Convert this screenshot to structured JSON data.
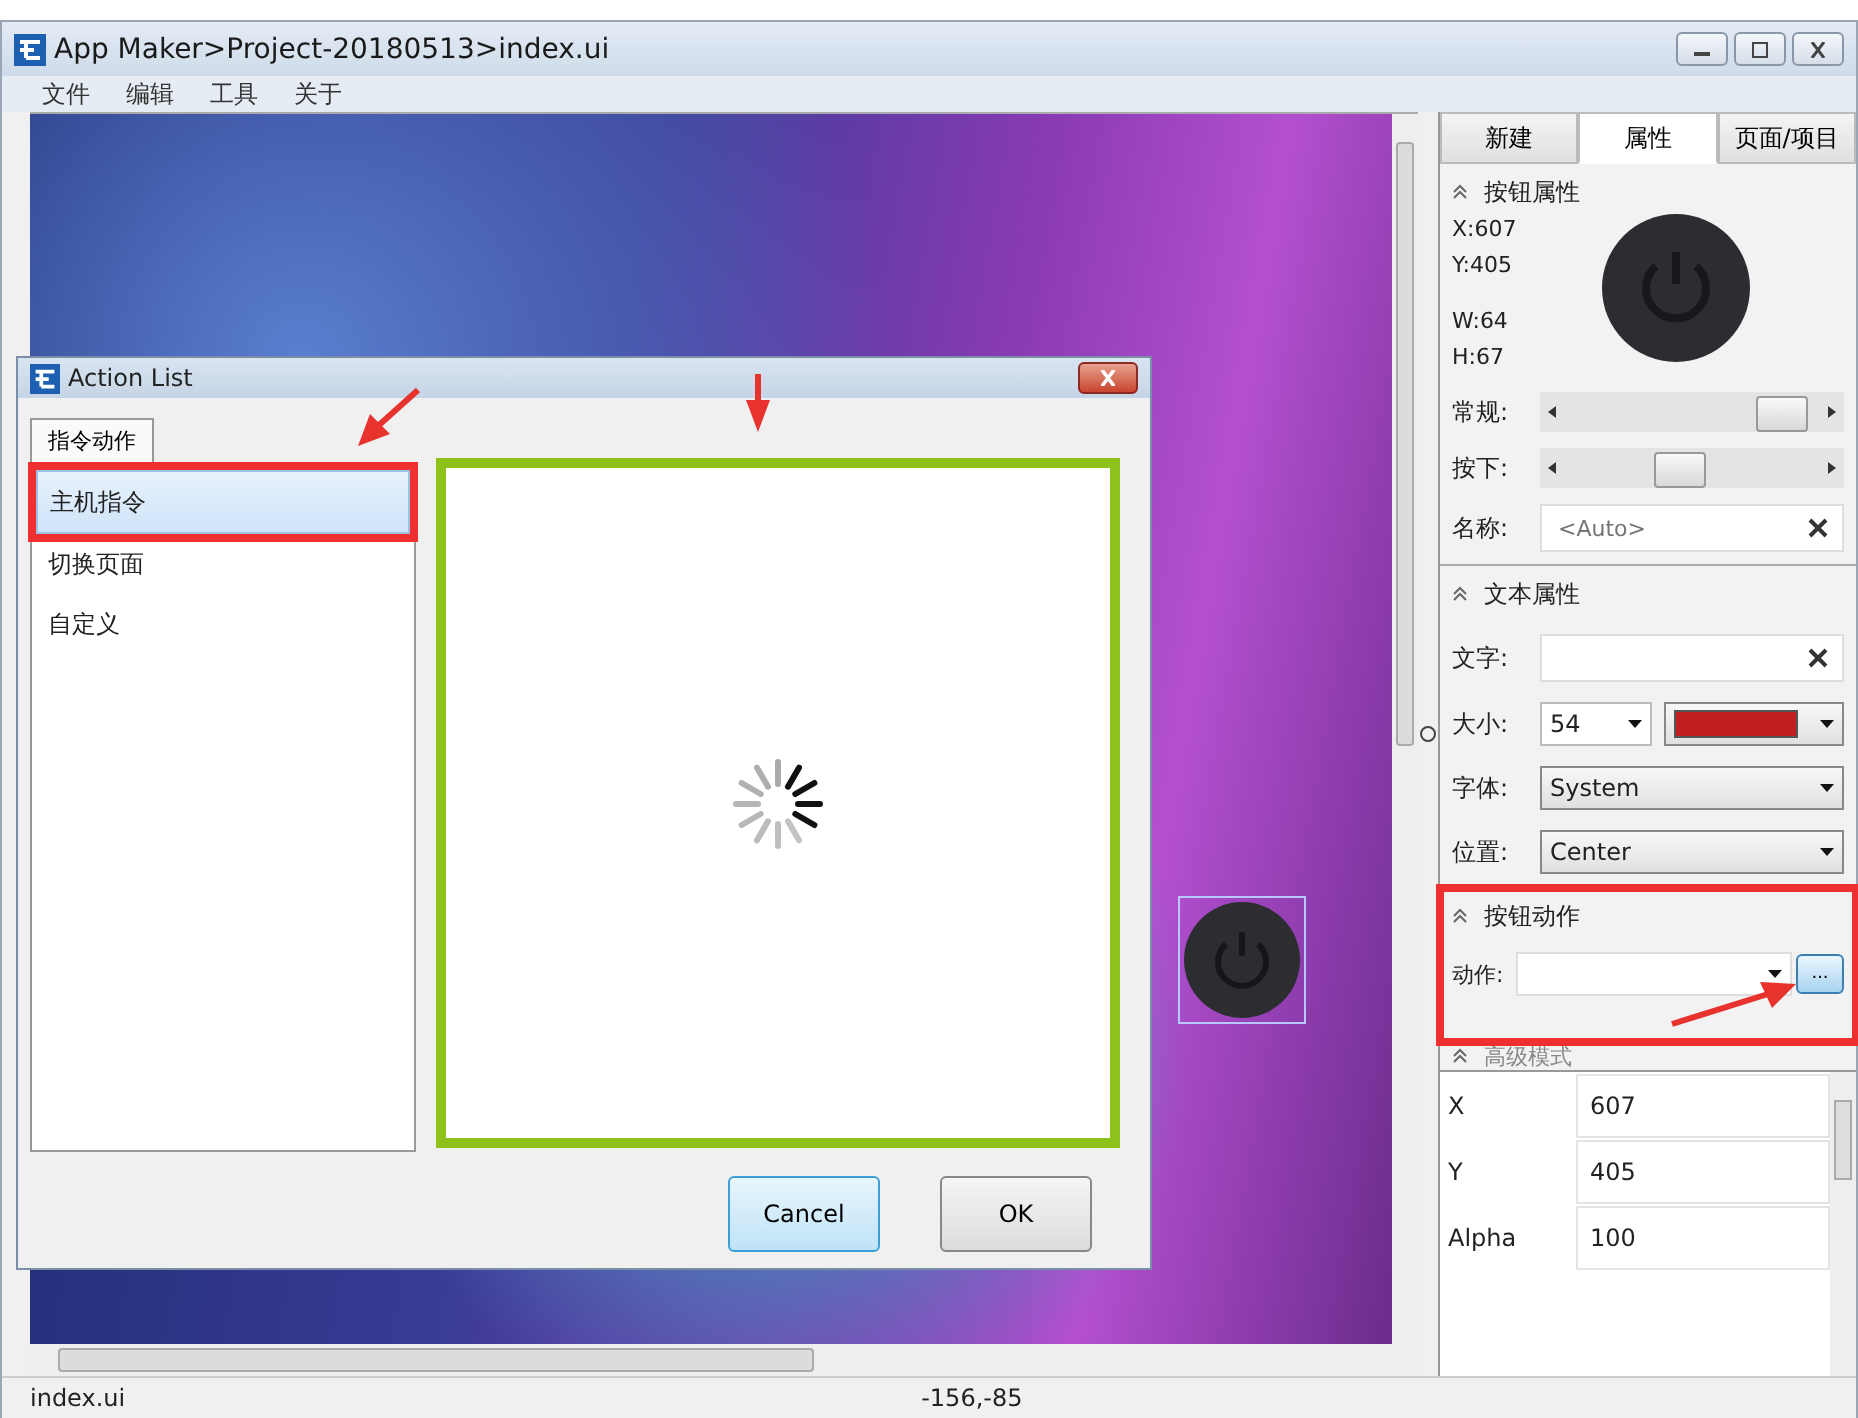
{
  "window": {
    "title": "App Maker>Project-20180513>index.ui"
  },
  "menu": [
    "文件",
    "编辑",
    "工具",
    "关于"
  ],
  "canvas": {
    "widget_selected": true
  },
  "right_panel": {
    "tabs": [
      {
        "label": "新建",
        "selected": false
      },
      {
        "label": "属性",
        "selected": true
      },
      {
        "label": "页面/项目",
        "selected": false
      }
    ],
    "button_props": {
      "title": "按钮属性",
      "x": "X:607",
      "y": "Y:405",
      "w": "W:64",
      "h": "H:67",
      "sliders": [
        {
          "label": "常规:",
          "level": 0.85
        },
        {
          "label": "按下:",
          "level": 0.45
        }
      ],
      "name": {
        "label": "名称:",
        "placeholder": "<Auto>"
      }
    },
    "text_props": {
      "title": "文本属性",
      "text_label": "文字:",
      "size_label": "大小:",
      "size": "54",
      "color": "#c0201f",
      "font_label": "字体:",
      "font": "System",
      "position_label": "位置:",
      "position": "Center"
    },
    "button_action": {
      "title": "按钮动作",
      "action_label": "动作:",
      "browse": "...",
      "highlighted": true
    },
    "advanced": {
      "title": "高级模式",
      "rows": [
        {
          "name": "X",
          "value": "607"
        },
        {
          "name": "Y",
          "value": "405"
        },
        {
          "name": "Alpha",
          "value": "100"
        }
      ]
    }
  },
  "dialog": {
    "title": "Action List",
    "tab": "指令动作",
    "items": [
      {
        "label": "主机指令",
        "selected": true
      },
      {
        "label": "切换页面",
        "selected": false
      },
      {
        "label": "自定义",
        "selected": false
      }
    ],
    "buttons": [
      {
        "label": "Cancel",
        "default": true
      },
      {
        "label": "OK",
        "default": false
      }
    ]
  },
  "status_bar": {
    "file": "index.ui",
    "coords": "-156,-85"
  }
}
